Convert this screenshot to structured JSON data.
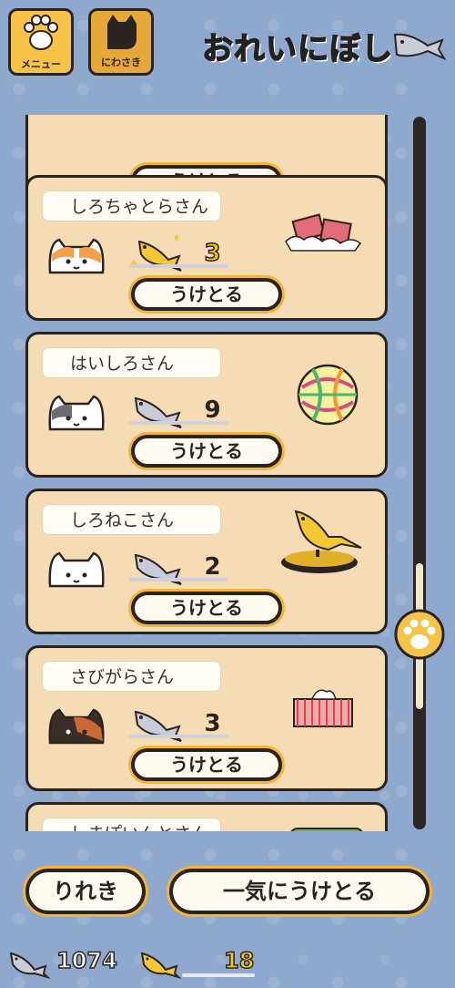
{
  "header": {
    "menu_label": "メニュー",
    "yard_label": "にわさき",
    "title": "おれいにぼし"
  },
  "cards": [
    {
      "name": "",
      "count": "",
      "button": "うけとる"
    },
    {
      "name": "しろちゃとらさん",
      "count": "3",
      "fish": "gold",
      "gift": "tissue-pieces"
    },
    {
      "name": "はいしろさん",
      "count": "9",
      "fish": "silver",
      "gift": "temari-ball"
    },
    {
      "name": "しろねこさん",
      "count": "2",
      "fish": "silver",
      "gift": "gold-fish-trophy"
    },
    {
      "name": "さびがらさん",
      "count": "3",
      "fish": "silver",
      "gift": "tissue-box"
    },
    {
      "name": "しまぽいんとさん",
      "count": "",
      "fish": "silver",
      "gift": "green-item"
    }
  ],
  "receive_label": "うけとる",
  "bottom": {
    "history_label": "りれき",
    "collect_all_label": "一気にうけとる"
  },
  "status": {
    "silver_fish": "1074",
    "gold_fish": "18"
  },
  "colors": {
    "background": "#8fa8cd",
    "card": "#f6dcb4",
    "accent": "#f3b536"
  }
}
